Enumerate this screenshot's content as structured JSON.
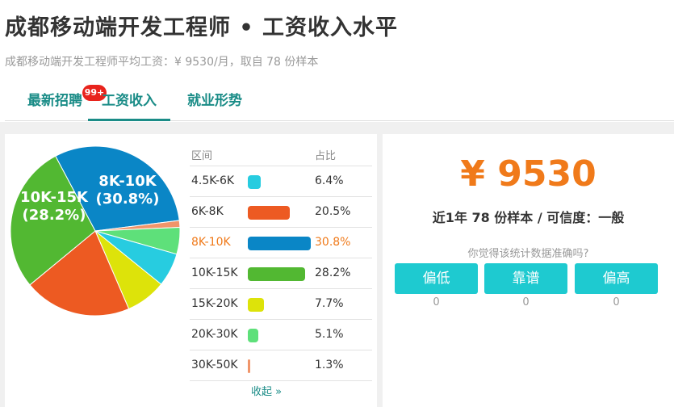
{
  "header": {
    "title": "成都移动端开发工程师 • 工资收入水平",
    "subtitle": "成都移动端开发工程师平均工资：¥ 9530/月，取自 78 份样本"
  },
  "tabs": [
    {
      "label": "最新招聘",
      "badge": "99+"
    },
    {
      "label": "工资收入"
    },
    {
      "label": "就业形势"
    }
  ],
  "table": {
    "col_range": "区间",
    "col_ratio": "占比",
    "collapse_label": "收起 »"
  },
  "chart_data": {
    "type": "pie",
    "categories": [
      "4.5K-6K",
      "6K-8K",
      "8K-10K",
      "10K-15K",
      "15K-20K",
      "20K-30K",
      "30K-50K"
    ],
    "values": [
      6.4,
      20.5,
      30.8,
      28.2,
      7.7,
      5.1,
      1.3
    ],
    "labels": [
      "6.4%",
      "20.5%",
      "30.8%",
      "28.2%",
      "7.7%",
      "5.1%",
      "1.3%"
    ],
    "colors": [
      "#27cce0",
      "#ed5a22",
      "#0a86c6",
      "#52b832",
      "#dde30a",
      "#5ee07a",
      "#f0956a"
    ],
    "pie_labels": [
      {
        "name": "8K-10K",
        "pct": "(30.8%)"
      },
      {
        "name": "10K-15K",
        "pct": "(28.2%)"
      }
    ],
    "highlight_index": 2
  },
  "summary": {
    "average": "¥ 9530",
    "sample_text": "近1年 78 份样本 / 可信度：一般",
    "question": "你觉得该统计数据准确吗?",
    "votes": [
      {
        "label": "偏低",
        "count": "0"
      },
      {
        "label": "靠谱",
        "count": "0"
      },
      {
        "label": "偏高",
        "count": "0"
      }
    ]
  }
}
